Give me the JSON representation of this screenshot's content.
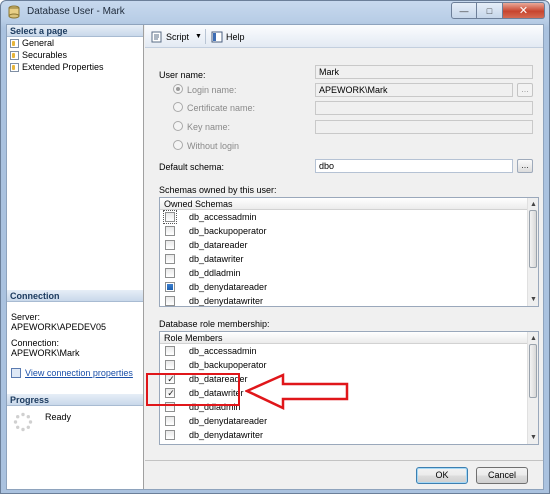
{
  "window": {
    "title": "Database User - Mark"
  },
  "left": {
    "select_page_header": "Select a page",
    "pages": [
      {
        "label": "General"
      },
      {
        "label": "Securables"
      },
      {
        "label": "Extended Properties"
      }
    ],
    "connection_header": "Connection",
    "server_label": "Server:",
    "server_value": "APEWORK\\APEDEV05",
    "connection_label": "Connection:",
    "connection_value": "APEWORK\\Mark",
    "view_conn_link": "View connection properties",
    "progress_header": "Progress",
    "progress_status": "Ready"
  },
  "toolbar": {
    "script_label": "Script",
    "help_label": "Help"
  },
  "form": {
    "user_name_label": "User name:",
    "user_name_value": "Mark",
    "login_name_label": "Login name:",
    "login_name_value": "APEWORK\\Mark",
    "certificate_label": "Certificate name:",
    "key_name_label": "Key name:",
    "without_login_label": "Without login",
    "default_schema_label": "Default schema:",
    "default_schema_value": "dbo",
    "browse_label": "...",
    "schemas_label": "Schemas owned by this user:",
    "schemas_header": "Owned Schemas",
    "schemas": [
      {
        "name": "db_accessadmin",
        "state": "unchecked",
        "focused": true
      },
      {
        "name": "db_backupoperator",
        "state": "unchecked"
      },
      {
        "name": "db_datareader",
        "state": "unchecked"
      },
      {
        "name": "db_datawriter",
        "state": "unchecked"
      },
      {
        "name": "db_ddladmin",
        "state": "unchecked"
      },
      {
        "name": "db_denydatareader",
        "state": "indeterminate"
      },
      {
        "name": "db_denydatawriter",
        "state": "unchecked"
      }
    ],
    "roles_label": "Database role membership:",
    "roles_header": "Role Members",
    "roles": [
      {
        "name": "db_accessadmin",
        "state": "unchecked"
      },
      {
        "name": "db_backupoperator",
        "state": "unchecked"
      },
      {
        "name": "db_datareader",
        "state": "checked"
      },
      {
        "name": "db_datawriter",
        "state": "checked"
      },
      {
        "name": "db_ddladmin",
        "state": "unchecked"
      },
      {
        "name": "db_denydatareader",
        "state": "unchecked"
      },
      {
        "name": "db_denydatawriter",
        "state": "unchecked"
      }
    ]
  },
  "buttons": {
    "ok": "OK",
    "cancel": "Cancel"
  },
  "colors": {
    "annotation_red": "#e0161a",
    "accent_blue": "#1a4fa8"
  }
}
